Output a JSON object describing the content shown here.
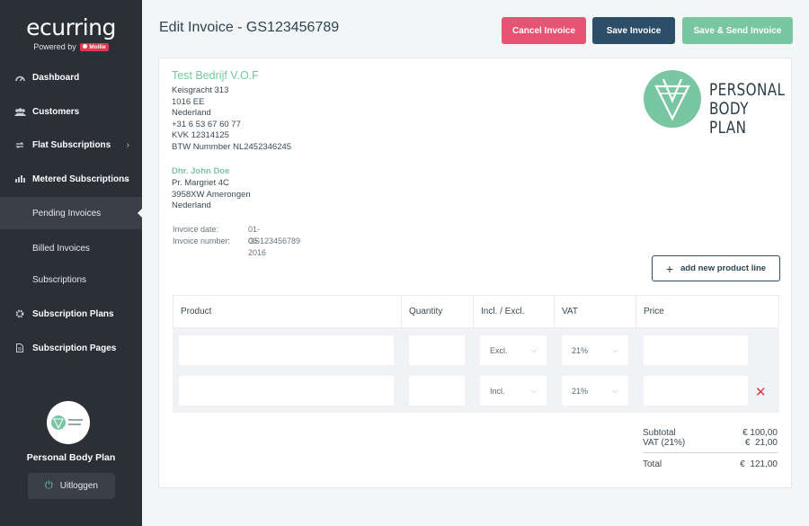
{
  "brand": {
    "logo": "ecurring",
    "powered_by": "Powered by",
    "partner_badge": "Mollie"
  },
  "sidebar": {
    "items": [
      {
        "label": "Dashboard",
        "icon": "gauge-icon"
      },
      {
        "label": "Customers",
        "icon": "users-icon"
      },
      {
        "label": "Flat Subscriptions",
        "icon": "refresh-icon"
      },
      {
        "label": "Metered Subscriptions",
        "icon": "bar-chart-icon"
      },
      {
        "label": "Pending Invoices"
      },
      {
        "label": "Billed Invoices"
      },
      {
        "label": "Subscriptions"
      },
      {
        "label": "Subscription Plans",
        "icon": "gear-icon"
      },
      {
        "label": "Subscription Pages",
        "icon": "document-icon"
      }
    ],
    "company_name": "Personal Body Plan",
    "logout_label": "Uitloggen"
  },
  "header": {
    "title": "Edit Invoice - GS123456789",
    "cancel_label": "Cancel Invoice",
    "save_label": "Save Invoice",
    "send_label": "Save & Send Invoice"
  },
  "invoice": {
    "seller": {
      "name": "Test Bedrijf V.O.F",
      "lines": [
        "Keisgracht 313",
        "1016 EE",
        "Nederland",
        "+31 6 53 67 60 77",
        "KVK 12314125",
        "BTW Nummber NL2452346245"
      ]
    },
    "buyer": {
      "name": "Dhr. John Doe",
      "lines": [
        "Pr. Margriet 4C",
        "3958XW Amerongen",
        "Nederland"
      ]
    },
    "meta": {
      "date_label": "Invoice date:",
      "date_value": "01-06-2016",
      "number_label": "Invoice number:",
      "number_value": "GS123456789"
    },
    "brand_text": [
      "PERSONAL",
      "BODY PLAN"
    ],
    "add_line_label": "add new product line",
    "columns": [
      "Product",
      "Quantity",
      "Incl. / Excl.",
      "VAT",
      "Price"
    ],
    "rows": [
      {
        "incl_excl": "Excl.",
        "vat": "21%"
      },
      {
        "incl_excl": "Incl.",
        "vat": "21%"
      }
    ],
    "totals": {
      "subtotal_label": "Subtotal",
      "subtotal_value": "€ 100,00",
      "vat_label": "VAT (21%)",
      "vat_value": "€  21,00",
      "total_label": "Total",
      "total_value": "€  121,00"
    }
  },
  "colors": {
    "sidebar_bg": "#2b2f36",
    "accent_green": "#79c6a2",
    "cancel_red": "#e65373",
    "navy": "#2d4e68"
  }
}
